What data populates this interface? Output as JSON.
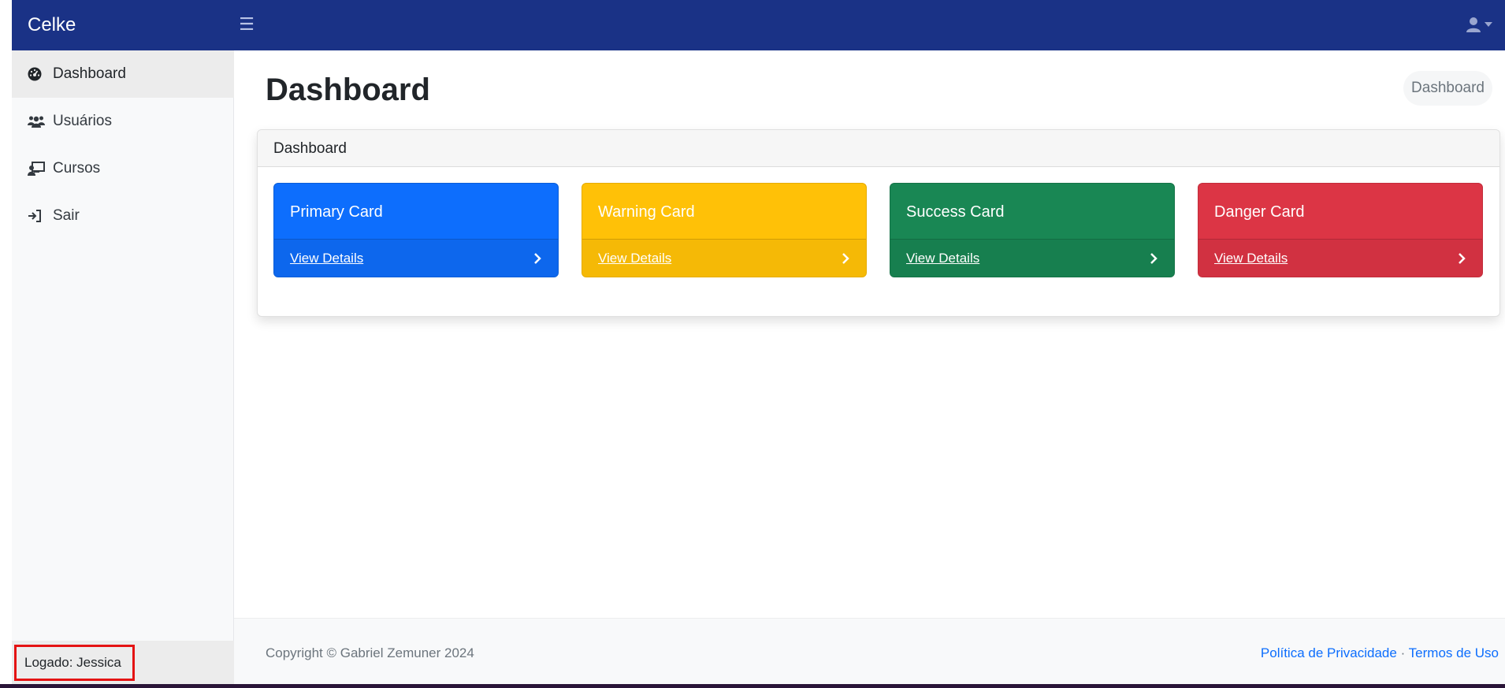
{
  "app": {
    "brand": "Celke"
  },
  "header": {
    "toggle_icon": "menu-icon",
    "user_icon": "user-icon"
  },
  "sidebar": {
    "items": [
      {
        "label": "Dashboard",
        "icon": "gauge-icon",
        "active": true
      },
      {
        "label": "Usuários",
        "icon": "users-icon",
        "active": false
      },
      {
        "label": "Cursos",
        "icon": "chalkboard-teacher-icon",
        "active": false
      },
      {
        "label": "Sair",
        "icon": "sign-out-icon",
        "active": false
      }
    ],
    "logged_user": "Logado: Jessica"
  },
  "main": {
    "title": "Dashboard",
    "breadcrumb": "Dashboard",
    "panel_title": "Dashboard",
    "cards": [
      {
        "title": "Primary Card",
        "link": "View Details",
        "color": "#0d6efd"
      },
      {
        "title": "Warning Card",
        "link": "View Details",
        "color": "#ffc107"
      },
      {
        "title": "Success Card",
        "link": "View Details",
        "color": "#198754"
      },
      {
        "title": "Danger Card",
        "link": "View Details",
        "color": "#dc3545"
      }
    ]
  },
  "footer": {
    "copyright": "Copyright © Gabriel Zemuner 2024",
    "privacy": "Política de Privacidade",
    "separator": "·",
    "terms": "Termos de Uso"
  },
  "colors": {
    "topbar": "#1a3286",
    "link": "#0d6efd"
  }
}
